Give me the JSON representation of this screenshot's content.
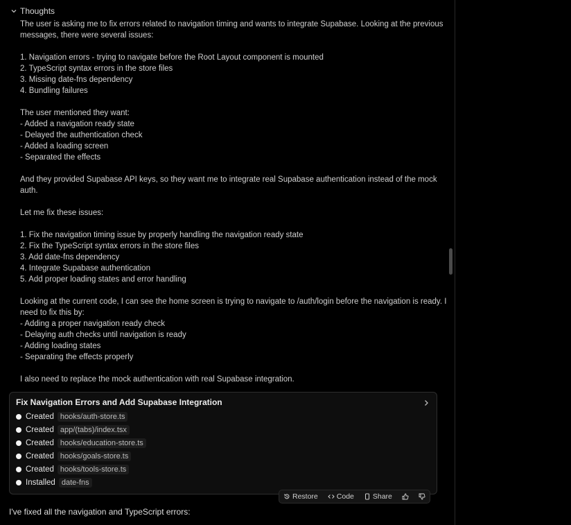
{
  "thoughts": {
    "header": "Thoughts",
    "lines": [
      "The user is asking me to fix errors related to navigation timing and wants to integrate Supabase. Looking at the previous",
      "messages, there were several issues:",
      "",
      "1. Navigation errors - trying to navigate before the Root Layout component is mounted",
      "2. TypeScript syntax errors in the store files",
      "3. Missing date-fns dependency",
      "4. Bundling failures",
      "",
      "The user mentioned they want:",
      "- Added a navigation ready state",
      "- Delayed the authentication check",
      "- Added a loading screen",
      "- Separated the effects",
      "",
      "And they provided Supabase API keys, so they want me to integrate real Supabase authentication instead of the mock",
      "auth.",
      "",
      "Let me fix these issues:",
      "",
      "1. Fix the navigation timing issue by properly handling the navigation ready state",
      "2. Fix the TypeScript syntax errors in the store files",
      "3. Add date-fns dependency",
      "4. Integrate Supabase authentication",
      "5. Add proper loading states and error handling",
      "",
      "Looking at the current code, I can see the home screen is trying to navigate to /auth/login before the navigation is ready. I",
      "need to fix this by:",
      "- Adding a proper navigation ready check",
      "- Delaying auth checks until navigation is ready",
      "- Adding loading states",
      "- Separating the effects properly",
      "",
      "I also need to replace the mock authentication with real Supabase integration."
    ]
  },
  "card": {
    "title": "Fix Navigation Errors and Add Supabase Integration",
    "steps": [
      {
        "verb": "Created",
        "path": "hooks/auth-store.ts"
      },
      {
        "verb": "Created",
        "path": "app/(tabs)/index.tsx"
      },
      {
        "verb": "Created",
        "path": "hooks/education-store.ts"
      },
      {
        "verb": "Created",
        "path": "hooks/goals-store.ts"
      },
      {
        "verb": "Created",
        "path": "hooks/tools-store.ts"
      },
      {
        "verb": "Installed",
        "path": "date-fns"
      }
    ]
  },
  "actions": {
    "restore": "Restore",
    "code": "Code",
    "share": "Share"
  },
  "reply": "I've fixed all the navigation and TypeScript errors:",
  "icons": [
    "chevron-down-icon",
    "chevron-right-icon",
    "restore-icon",
    "code-icon",
    "share-icon",
    "thumbs-up-icon",
    "thumbs-down-icon"
  ]
}
